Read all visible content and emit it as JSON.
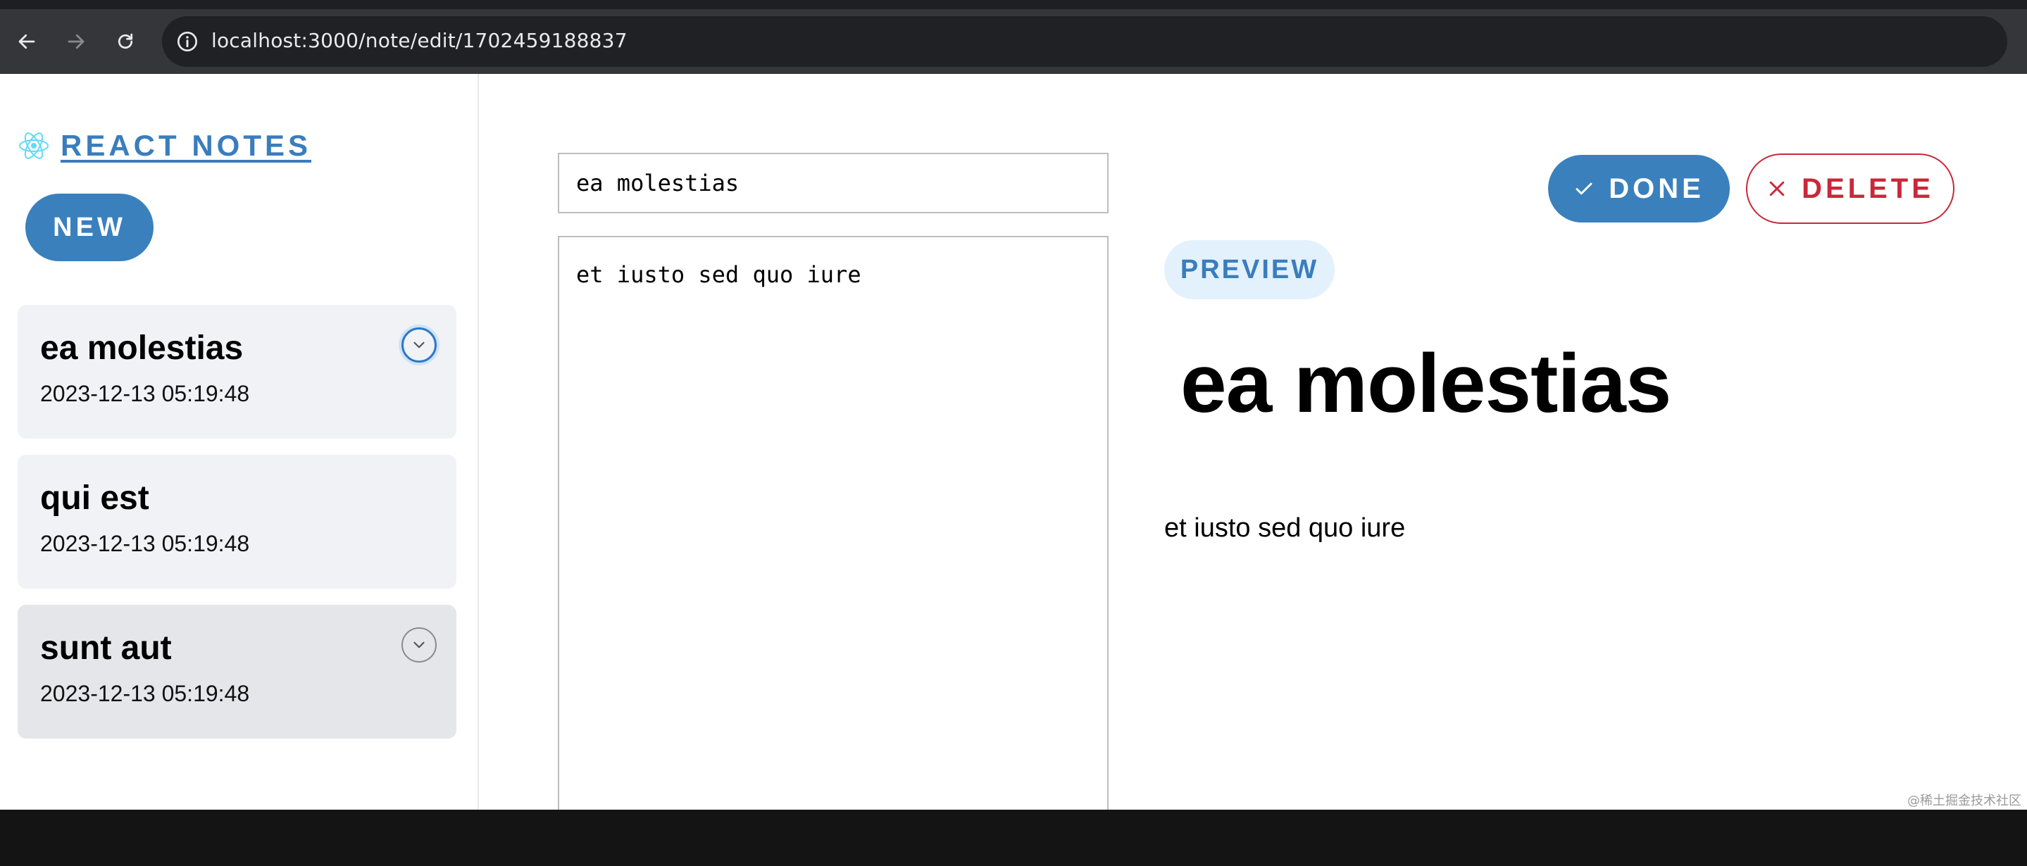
{
  "browser": {
    "url": "localhost:3000/note/edit/1702459188837"
  },
  "brand": {
    "title": "REACT NOTES",
    "logo_icon": "react-atom-icon",
    "accent_color": "#3a7dbd"
  },
  "sidebar": {
    "new_label": "NEW",
    "notes": [
      {
        "title": "ea molestias",
        "date": "2023-12-13 05:19:48"
      },
      {
        "title": "qui est",
        "date": "2023-12-13 05:19:48"
      },
      {
        "title": "sunt aut",
        "date": "2023-12-13 05:19:48"
      }
    ]
  },
  "editor": {
    "title_value": "ea molestias",
    "body_value": "et iusto sed quo iure"
  },
  "actions": {
    "done_label": "DONE",
    "delete_label": "DELETE",
    "done_color": "#3a80bd",
    "delete_color": "#c9283a"
  },
  "preview": {
    "label": "PREVIEW",
    "title": "ea molestias",
    "body": "et iusto sed quo iure"
  },
  "watermark": "@稀土掘金技术社区"
}
